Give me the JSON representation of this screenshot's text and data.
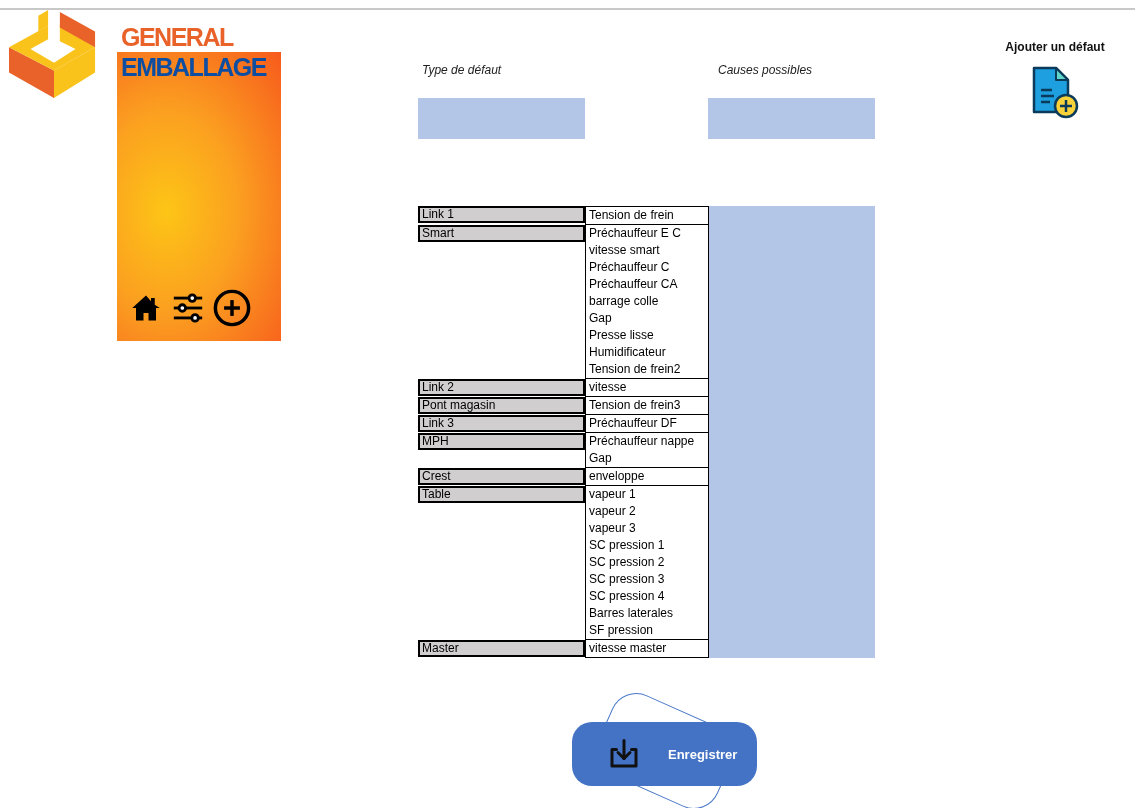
{
  "logo": {
    "line_1": "GENERAL",
    "line_2": "EMBALLAGE"
  },
  "headers": {
    "type": "Type de défaut",
    "causes": "Causes possibles"
  },
  "groups": [
    {
      "type": "Link 1",
      "causes": [
        "Tension de frein"
      ]
    },
    {
      "type": "Smart",
      "causes": [
        "Préchauffeur E C",
        "vitesse smart",
        "Préchauffeur C",
        "Préchauffeur CA",
        "barrage colle",
        "Gap",
        "Presse lisse",
        "Humidificateur",
        "Tension de frein2"
      ]
    },
    {
      "type": "Link 2",
      "causes": [
        "vitesse"
      ]
    },
    {
      "type": "Pont magasin",
      "causes": [
        "Tension de frein3"
      ]
    },
    {
      "type": "Link 3",
      "causes": [
        "Préchauffeur DF"
      ]
    },
    {
      "type": "MPH",
      "causes": [
        "Préchauffeur nappe",
        "Gap"
      ]
    },
    {
      "type": "Crest",
      "causes": [
        "enveloppe"
      ]
    },
    {
      "type": "Table",
      "causes": [
        "vapeur 1",
        "vapeur 2",
        "vapeur 3",
        "SC pression 1",
        "SC pression 2",
        "SC pression 3",
        "SC pression 4",
        "Barres laterales",
        "SF pression"
      ]
    },
    {
      "type": "Master",
      "causes": [
        "vitesse master"
      ]
    }
  ],
  "save_button": {
    "label": "Enregistrer"
  },
  "add_defect": {
    "label": "Ajouter un défaut"
  }
}
